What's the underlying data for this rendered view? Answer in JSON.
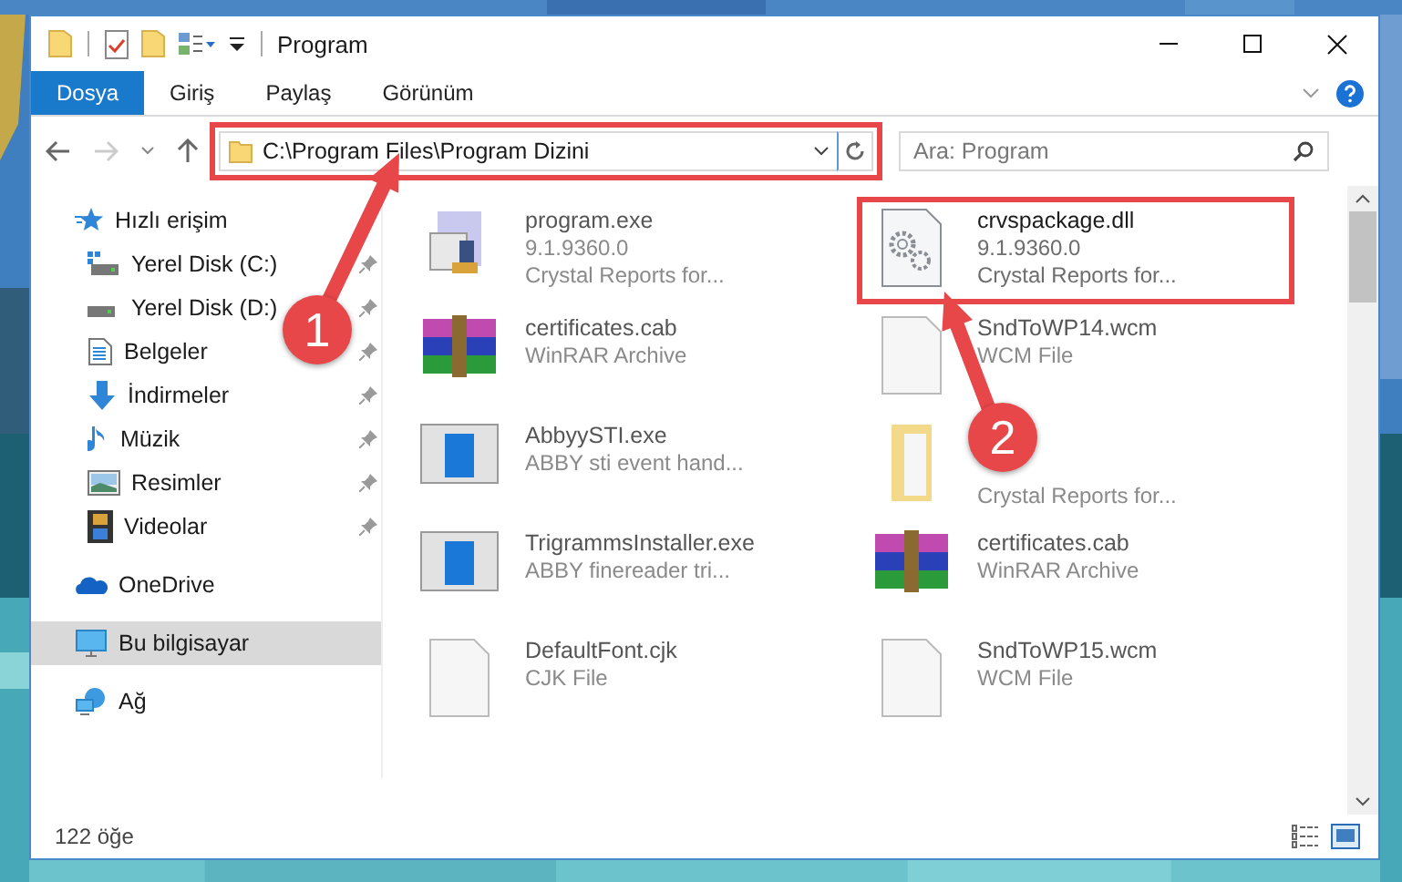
{
  "window": {
    "title": "Program"
  },
  "ribbon_tabs": [
    {
      "label": "Dosya",
      "selected": true
    },
    {
      "label": "Giriş",
      "selected": false
    },
    {
      "label": "Paylaş",
      "selected": false
    },
    {
      "label": "Görünüm",
      "selected": false
    }
  ],
  "address": {
    "path": "C:\\Program Files\\Program Dizini",
    "highlighted": true
  },
  "search": {
    "placeholder": "Ara: Program"
  },
  "sidebar": {
    "items": [
      {
        "label": "Hızlı erişim",
        "kind": "quick",
        "selected": false,
        "children": [
          {
            "label": "Yerel Disk (C:)",
            "kind": "drive-c",
            "pinned": true,
            "selected": false
          },
          {
            "label": "Yerel Disk (D:)",
            "kind": "drive",
            "pinned": true,
            "selected": false
          },
          {
            "label": "Belgeler",
            "kind": "docs",
            "pinned": true,
            "selected": false
          },
          {
            "label": "İndirmeler",
            "kind": "downloads",
            "pinned": true,
            "selected": false
          },
          {
            "label": "Müzik",
            "kind": "music",
            "pinned": true,
            "selected": false
          },
          {
            "label": "Resimler",
            "kind": "pictures",
            "pinned": true,
            "selected": false
          },
          {
            "label": "Videolar",
            "kind": "videos",
            "pinned": true,
            "selected": false
          }
        ]
      },
      {
        "label": "OneDrive",
        "kind": "cloud",
        "selected": false
      },
      {
        "label": "Bu bilgisayar",
        "kind": "pc",
        "selected": true
      },
      {
        "label": "Ağ",
        "kind": "network",
        "selected": false
      }
    ]
  },
  "files": [
    {
      "name": "program.exe",
      "details": [
        "9.1.9360.0",
        "Crystal Reports for..."
      ],
      "kind": "setup",
      "blurred": true,
      "highlighted": false
    },
    {
      "name": "crvspackage.dll",
      "details": [
        "9.1.9360.0",
        "Crystal Reports for..."
      ],
      "kind": "dll",
      "blurred": false,
      "highlighted": true
    },
    {
      "name": "certificates.cab",
      "details": [
        "WinRAR Archive"
      ],
      "kind": "archive",
      "blurred": true,
      "highlighted": false
    },
    {
      "name": "SndToWP14.wcm",
      "details": [
        "WCM File"
      ],
      "kind": "file",
      "blurred": true,
      "highlighted": false
    },
    {
      "name": "AbbyySTI.exe",
      "details": [
        "ABBY sti event hand..."
      ],
      "kind": "app",
      "blurred": true,
      "highlighted": false
    },
    {
      "details": [
        "Crystal Reports for..."
      ],
      "kind": "folder",
      "blurred": true,
      "highlighted": false
    },
    {
      "name": "TrigrammsInstaller.exe",
      "details": [
        "ABBY finereader tri..."
      ],
      "kind": "app",
      "blurred": true,
      "highlighted": false
    },
    {
      "name": "certificates.cab",
      "details": [
        "WinRAR Archive"
      ],
      "kind": "archive",
      "blurred": true,
      "highlighted": false
    },
    {
      "name": "DefaultFont.cjk",
      "details": [
        "CJK File"
      ],
      "kind": "file",
      "blurred": true,
      "highlighted": false
    },
    {
      "name": "SndToWP15.wcm",
      "details": [
        "WCM File"
      ],
      "kind": "file",
      "blurred": true,
      "highlighted": false
    }
  ],
  "status_bar": {
    "count": "122 öğe"
  },
  "annotations": [
    {
      "label": "1"
    },
    {
      "label": "2"
    }
  ]
}
